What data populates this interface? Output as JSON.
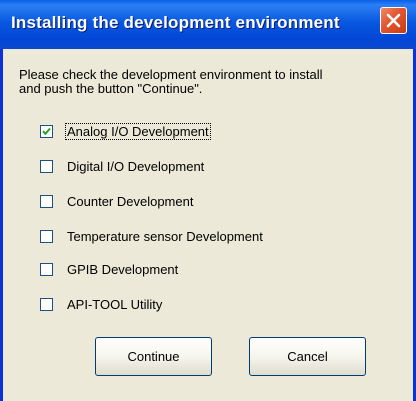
{
  "window": {
    "title": "Installing the development environment",
    "close_label": "Close"
  },
  "instructions": {
    "line1": "Please check the development environment to install",
    "line2": "and push the button \"Continue\"."
  },
  "options": [
    {
      "label": "Analog I/O Development",
      "checked": true
    },
    {
      "label": "Digital I/O Development",
      "checked": false
    },
    {
      "label": "Counter Development",
      "checked": false
    },
    {
      "label": "Temperature sensor Development",
      "checked": false
    },
    {
      "label": "GPIB Development",
      "checked": false
    },
    {
      "label": "API-TOOL Utility",
      "checked": false
    }
  ],
  "buttons": {
    "continue_label": "Continue",
    "cancel_label": "Cancel"
  },
  "colors": {
    "titlebar": "#0858e0",
    "client_bg": "#ece9d8",
    "close_button": "#e2552e"
  }
}
